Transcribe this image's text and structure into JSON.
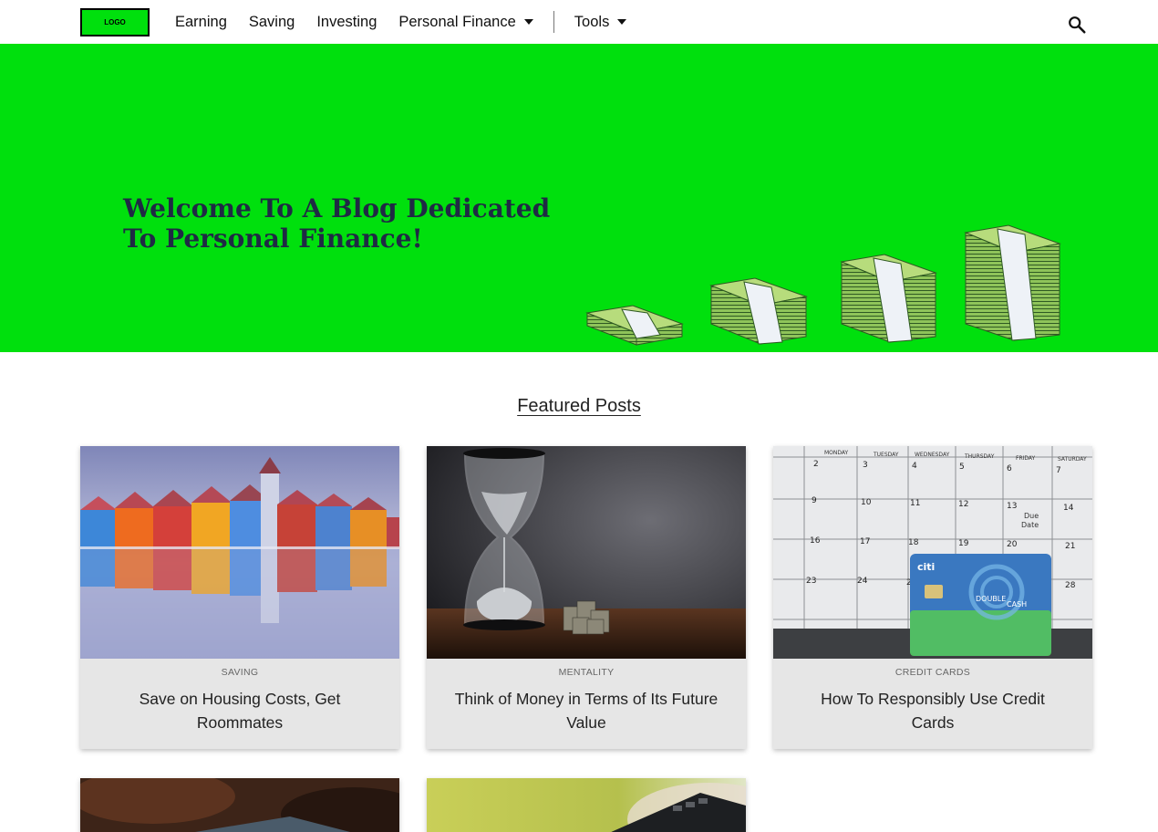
{
  "nav": {
    "logo_text": "LOGO",
    "items": [
      {
        "label": "Earning"
      },
      {
        "label": "Saving"
      },
      {
        "label": "Investing"
      },
      {
        "label": "Personal Finance"
      },
      {
        "label": "Tools"
      }
    ],
    "search_icon": "search-icon"
  },
  "hero": {
    "title": "Welcome To A Blog Dedicated To Personal Finance!",
    "background": "#00e00d"
  },
  "featured": {
    "heading": "Featured Posts",
    "posts": [
      {
        "category": "SAVING",
        "title": "Save on Housing Costs, Get Roommates"
      },
      {
        "category": "MENTALITY",
        "title": "Think of Money in Terms of Its Future Value"
      },
      {
        "category": "CREDIT CARDS",
        "title": "How To Responsibly Use Credit Cards"
      }
    ]
  },
  "images": {
    "calendar_days": [
      "MONDAY",
      "TUESDAY",
      "WEDNESDAY",
      "THURSDAY",
      "FRIDAY",
      "SATURDAY"
    ],
    "calendar_note_1": "Due",
    "calendar_note_2": "Date",
    "card_brand": "citi",
    "card_name_1": "DOUBLE",
    "card_name_2": "CASH"
  },
  "colors": {
    "accent_green": "#00e00d",
    "card_bg": "#e6e6e6",
    "hero_text": "#1f2a44"
  }
}
